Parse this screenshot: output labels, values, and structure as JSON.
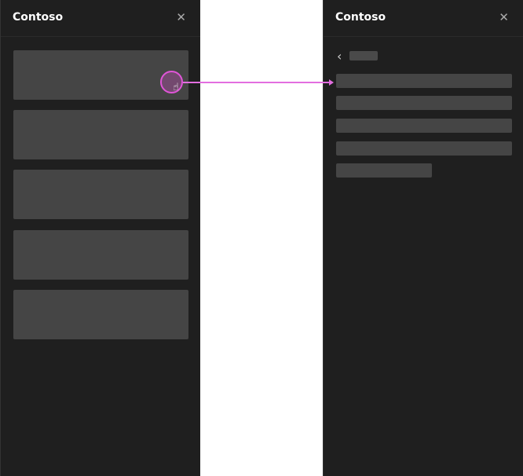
{
  "left_panel": {
    "title": "Contoso",
    "close_icon": "close-icon",
    "cards": 5
  },
  "right_panel": {
    "title": "Contoso",
    "close_icon": "close-icon",
    "back_icon": "chevron-left-icon",
    "rows": 5
  },
  "annotation": {
    "color": "#e055d8",
    "cursor": "hand-pointer-icon"
  }
}
